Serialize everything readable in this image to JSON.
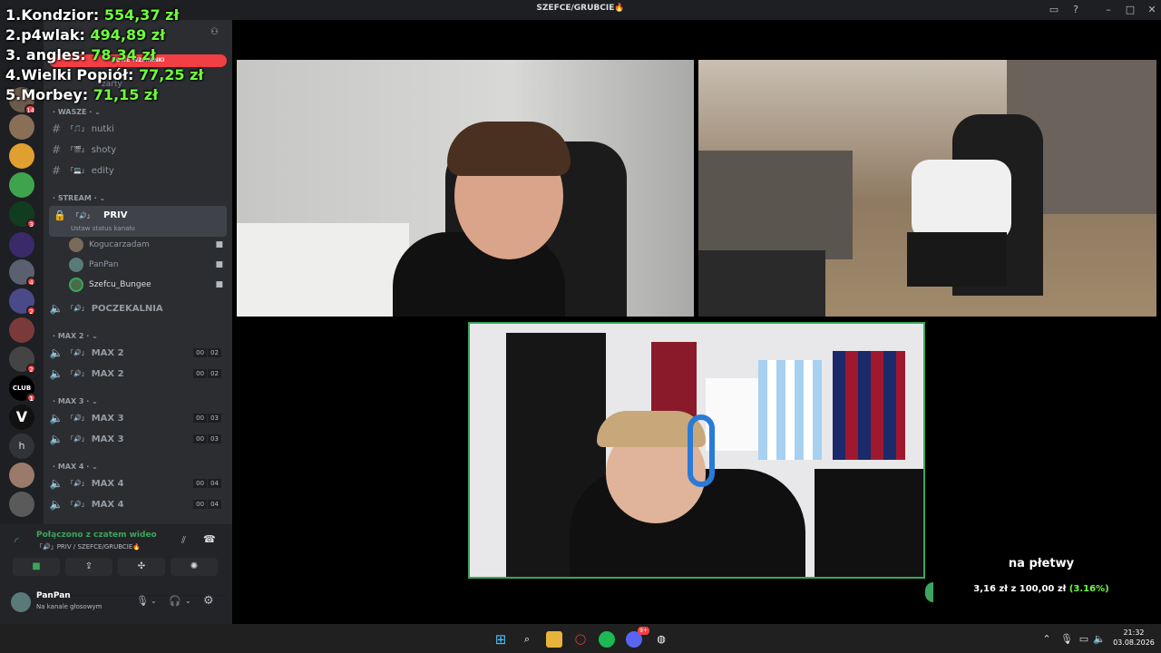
{
  "window": {
    "title": "SZEFCE/GRUBCIE🔥"
  },
  "leaderboard": [
    {
      "rank_name": "1.Kondzior:",
      "amount": "554,37 zł"
    },
    {
      "rank_name": "2.p4wlak:",
      "amount": "494,89 zł"
    },
    {
      "rank_name": "3. angles:",
      "amount": "78,34 zł"
    },
    {
      "rank_name": "4.Wielki Popiół:",
      "amount": "77,25 zł"
    },
    {
      "rank_name": "5.Morbey:",
      "amount": "71,15 zł"
    }
  ],
  "guild_badges": [
    "14",
    "3",
    "4",
    "2",
    "2",
    "1"
  ],
  "guild_letter": "h",
  "server_header": {
    "mentions_banner": "NOWE WZMIANKI",
    "partial_channel": "żarty"
  },
  "categories": {
    "wasze": "WASZE",
    "stream": "STREAM",
    "max2": "MAX 2",
    "max3": "MAX 3",
    "max4": "MAX 4"
  },
  "text_channels": [
    {
      "name": "nutki",
      "emoji": "「🎵」"
    },
    {
      "name": "shoty",
      "emoji": "「🎬」"
    },
    {
      "name": "edity",
      "emoji": "「💻」"
    }
  ],
  "priv_channel": {
    "name": "PRIV",
    "emoji": "「🔊」",
    "status": "Ustaw status kanału"
  },
  "priv_users": [
    "Kogucarzadam",
    "PanPan",
    "Szefcu_Bungee"
  ],
  "poczekalnia": {
    "name": "POCZEKALNIA",
    "emoji": "「🔊」"
  },
  "max_channels": {
    "max2": [
      {
        "name": "MAX 2",
        "c1": "00",
        "c2": "02"
      },
      {
        "name": "MAX 2",
        "c1": "00",
        "c2": "02"
      }
    ],
    "max3": [
      {
        "name": "MAX 3",
        "c1": "00",
        "c2": "03"
      },
      {
        "name": "MAX 3",
        "c1": "00",
        "c2": "03"
      }
    ],
    "max4": [
      {
        "name": "MAX 4",
        "c1": "00",
        "c2": "04"
      },
      {
        "name": "MAX 4",
        "c1": "00",
        "c2": "04"
      }
    ]
  },
  "voice_connection": {
    "status": "Połączono z czatem wideo",
    "channel": "「🔊」PRIV / SZEFCE/GRUBCIE🔥"
  },
  "user_panel": {
    "name": "PanPan",
    "status": "Na kanale głosowym"
  },
  "donation": {
    "message": "na płetwy",
    "current": "3,16 zł",
    "connector": "z",
    "goal": "100,00 zł",
    "percent": "(3.16%)",
    "progress": 0.0316
  },
  "taskbar": {
    "time": "21:32",
    "date": "03.08.2026",
    "discord_badge": "9+"
  },
  "colors": {
    "accent_green": "#6fff3a",
    "discord_bg": "#2b2d31",
    "speaking_border": "#3ba55c",
    "mention_red": "#f23f43"
  }
}
